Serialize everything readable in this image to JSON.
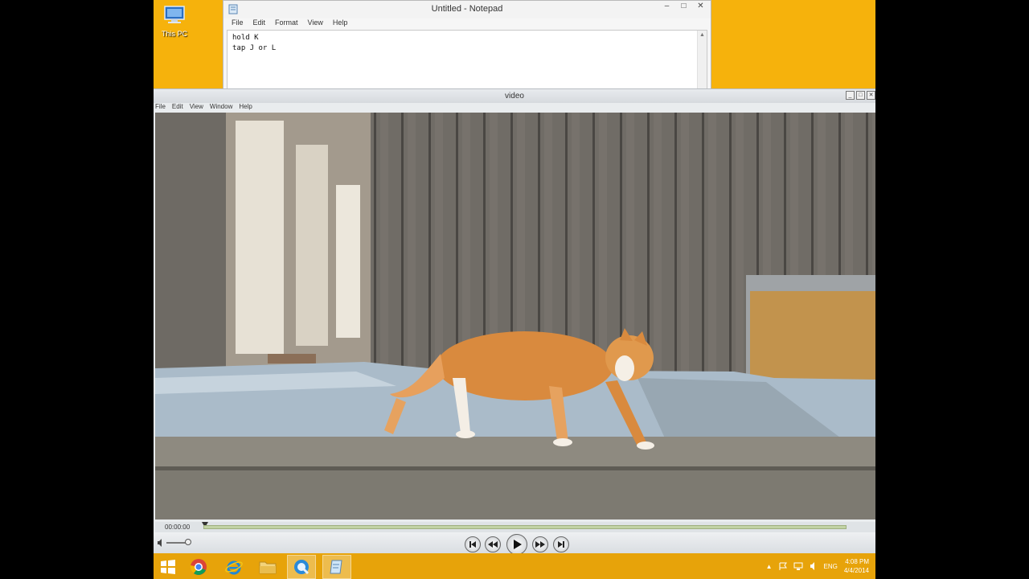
{
  "desktop": {
    "icon_label": "This PC",
    "background_color": "#f6b20c"
  },
  "notepad": {
    "title": "Untitled - Notepad",
    "menu": [
      "File",
      "Edit",
      "Format",
      "View",
      "Help"
    ],
    "controls": {
      "minimize": "–",
      "maximize": "□",
      "close": "✕"
    },
    "lines": [
      "hold K",
      "tap J or L"
    ]
  },
  "video_window": {
    "title": "video",
    "menu": [
      "File",
      "Edit",
      "View",
      "Window",
      "Help"
    ],
    "time": "00:00:00",
    "progress": 0.0
  },
  "taskbar": {
    "apps": [
      "start-icon",
      "chrome-icon",
      "internet-explorer-icon",
      "file-explorer-icon",
      "quicktime-icon",
      "notepad-icon"
    ],
    "tray_language": "ENG",
    "clock_time": "4:08 PM",
    "clock_date": "4/4/2014"
  }
}
